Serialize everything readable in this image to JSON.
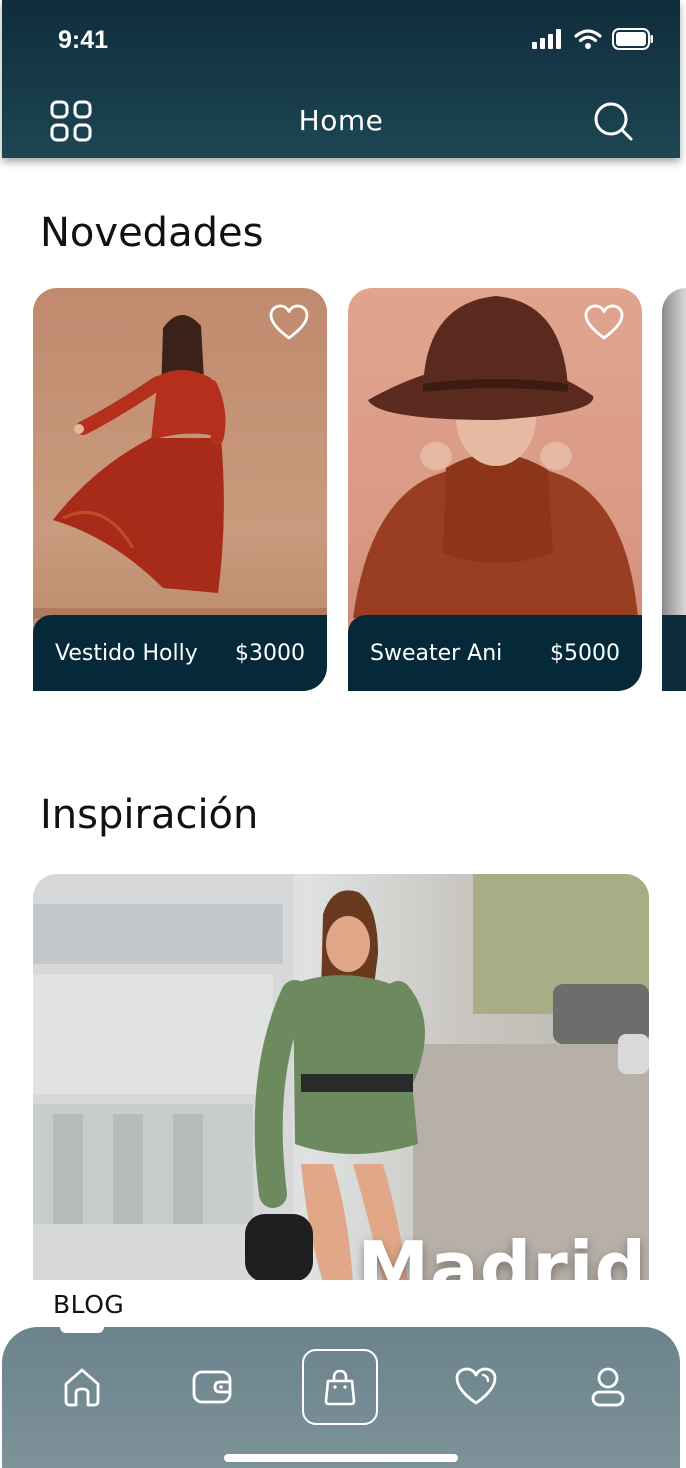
{
  "status_bar": {
    "time": "9:41"
  },
  "header": {
    "title": "Home"
  },
  "sections": {
    "new_title": "Novedades",
    "inspiration_title": "Inspiración"
  },
  "products": [
    {
      "name": "Vestido Holly",
      "price": "$3000"
    },
    {
      "name": "Sweater Ani",
      "price": "$5000"
    }
  ],
  "blog": {
    "label": "BLOG",
    "overlay": "Madrid"
  },
  "colors": {
    "header": "#0f2d3c",
    "card_footer": "#06293a",
    "nav": "#6c838c"
  }
}
